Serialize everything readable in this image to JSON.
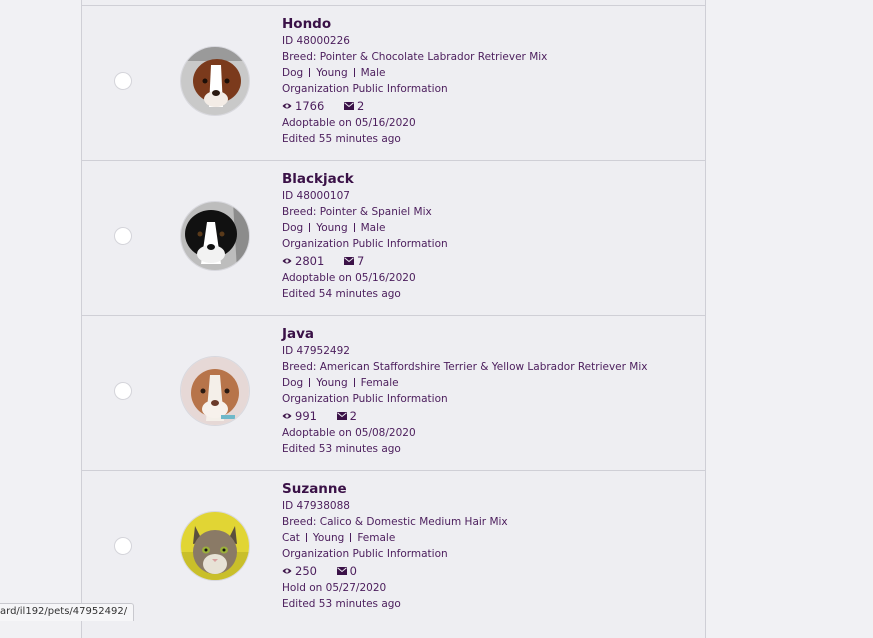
{
  "pets": [
    {
      "name": "Hondo",
      "id": "ID 48000226",
      "breed": "Breed: Pointer & Chocolate Labrador Retriever Mix",
      "species": "Dog",
      "age": "Young",
      "gender": "Male",
      "org_info": "Organization Public Information",
      "views": "1766",
      "messages": "2",
      "status": "Adoptable on 05/16/2020",
      "edited": "Edited 55 minutes ago",
      "photo_colors": [
        "#7b3a1c",
        "#ffffff",
        "#c9c9c9"
      ]
    },
    {
      "name": "Blackjack",
      "id": "ID 48000107",
      "breed": "Breed: Pointer & Spaniel Mix",
      "species": "Dog",
      "age": "Young",
      "gender": "Male",
      "org_info": "Organization Public Information",
      "views": "2801",
      "messages": "7",
      "status": "Adoptable on 05/16/2020",
      "edited": "Edited 54 minutes ago",
      "photo_colors": [
        "#111111",
        "#ffffff",
        "#bdbdbd"
      ]
    },
    {
      "name": "Java",
      "id": "ID 47952492",
      "breed": "Breed: American Staffordshire Terrier & Yellow Labrador Retriever Mix",
      "species": "Dog",
      "age": "Young",
      "gender": "Female",
      "org_info": "Organization Public Information",
      "views": "991",
      "messages": "2",
      "status": "Adoptable on 05/08/2020",
      "edited": "Edited 53 minutes ago",
      "photo_colors": [
        "#b7744a",
        "#f4efe9",
        "#e6d8d6"
      ]
    },
    {
      "name": "Suzanne",
      "id": "ID 47938088",
      "breed": "Breed: Calico & Domestic Medium Hair Mix",
      "species": "Cat",
      "age": "Young",
      "gender": "Female",
      "org_info": "Organization Public Information",
      "views": "250",
      "messages": "0",
      "status": "Hold on 05/27/2020",
      "edited": "Edited 53 minutes ago",
      "photo_colors": [
        "#8a7a66",
        "#e7e2d6",
        "#e1d534"
      ]
    }
  ],
  "icons": {
    "views": "eye-icon",
    "messages": "envelope-icon"
  },
  "status_bar": {
    "url": "ard/il192/pets/47952492/"
  },
  "colors": {
    "accent": "#4b1d5c",
    "background": "#eeeef2",
    "border": "#cfcfd6"
  }
}
